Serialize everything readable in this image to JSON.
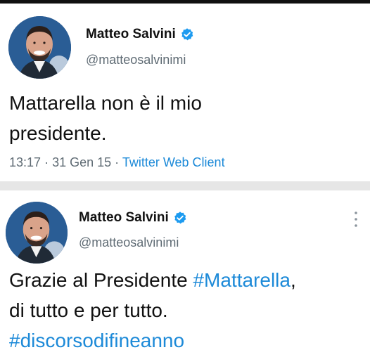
{
  "colors": {
    "link": "#1d8ad8",
    "verified_badge": "#1d9bf0",
    "separator": "#e6e6e6",
    "secondary_text": "#5f6b74"
  },
  "tweets": [
    {
      "display_name": "Matteo Salvini",
      "handle": "@matteosalvinimi",
      "verified": true,
      "text_lines": [
        "Mattarella non è il mio",
        "presidente."
      ],
      "time": "13:17",
      "date": "31 Gen 15",
      "source": "Twitter Web Client",
      "separator_dot": "·"
    },
    {
      "display_name": "Matteo Salvini",
      "handle": "@matteosalvinimi",
      "verified": true,
      "line1_text": "Grazie al Presidente ",
      "line1_hashtag": "#Mattarella",
      "line1_suffix": ",",
      "line2_text": "di tutto e per tutto.",
      "line3_hashtag": "#discorsodifineanno",
      "more_icon": "more-vertical-icon"
    }
  ]
}
